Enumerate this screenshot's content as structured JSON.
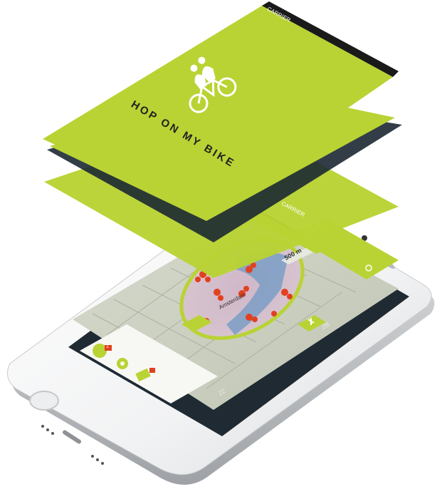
{
  "app": {
    "brand_title": "HOP ON MY BIKE",
    "accent": "#b9d334",
    "status_bar": {
      "carrier": "CARRIER"
    }
  },
  "map": {
    "city_label": "Amsterdam",
    "radius_label": "500 m",
    "marker_color": "#e2401f",
    "badge_label": "2B",
    "side_value": "22"
  },
  "controls": {
    "search_icon": "search-icon",
    "collapse_icon": "collapse-icon",
    "zoom_in_icon": "plus-icon",
    "settings_icon": "gear-icon",
    "messages_icon": "envelope-icon",
    "profile_icon": "person-icon",
    "notification_badge": "1"
  }
}
